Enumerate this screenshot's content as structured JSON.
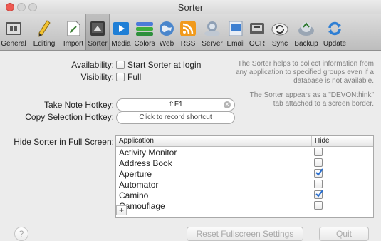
{
  "window": {
    "title": "Sorter"
  },
  "toolbar": {
    "items": [
      {
        "label": "General",
        "icon": "general-icon"
      },
      {
        "label": "Editing",
        "icon": "pencil-icon"
      },
      {
        "label": "Import",
        "icon": "import-icon"
      },
      {
        "label": "Sorter",
        "icon": "sorter-icon",
        "selected": true
      },
      {
        "label": "Media",
        "icon": "media-icon"
      },
      {
        "label": "Colors",
        "icon": "colors-icon"
      },
      {
        "label": "Web",
        "icon": "globe-icon"
      },
      {
        "label": "RSS",
        "icon": "rss-icon"
      },
      {
        "label": "Server",
        "icon": "server-icon"
      },
      {
        "label": "Email",
        "icon": "email-icon"
      },
      {
        "label": "OCR",
        "icon": "ocr-icon"
      },
      {
        "label": "Sync",
        "icon": "sync-icon"
      },
      {
        "label": "Backup",
        "icon": "backup-icon"
      },
      {
        "label": "Update",
        "icon": "update-icon"
      }
    ]
  },
  "settings": {
    "availability_label": "Availability:",
    "start_at_login_label": "Start Sorter at login",
    "start_at_login_checked": false,
    "visibility_label": "Visibility:",
    "full_label": "Full",
    "full_checked": false,
    "note1": "The Sorter helps to collect information from any application to specified groups even if a database is not available.",
    "note2": "The Sorter appears as a \"DEVONthink\" tab attached to a screen border.",
    "take_note_label": "Take Note Hotkey:",
    "take_note_value": "⇧F1",
    "copy_selection_label": "Copy Selection Hotkey:",
    "copy_selection_placeholder": "Click to record shortcut",
    "hide_label": "Hide Sorter in Full Screen:"
  },
  "table": {
    "columns": [
      "Application",
      "Hide"
    ],
    "rows": [
      {
        "name": "Activity Monitor",
        "hide": false
      },
      {
        "name": "Address Book",
        "hide": false
      },
      {
        "name": "Aperture",
        "hide": true
      },
      {
        "name": "Automator",
        "hide": false
      },
      {
        "name": "Camino",
        "hide": true
      },
      {
        "name": "Camouflage",
        "hide": false
      }
    ],
    "add_label": "+"
  },
  "buttons": {
    "help": "?",
    "reset": "Reset Fullscreen Settings",
    "quit": "Quit"
  },
  "colors": {
    "accent": "#2a6fcf",
    "close": "#ee5a52"
  }
}
